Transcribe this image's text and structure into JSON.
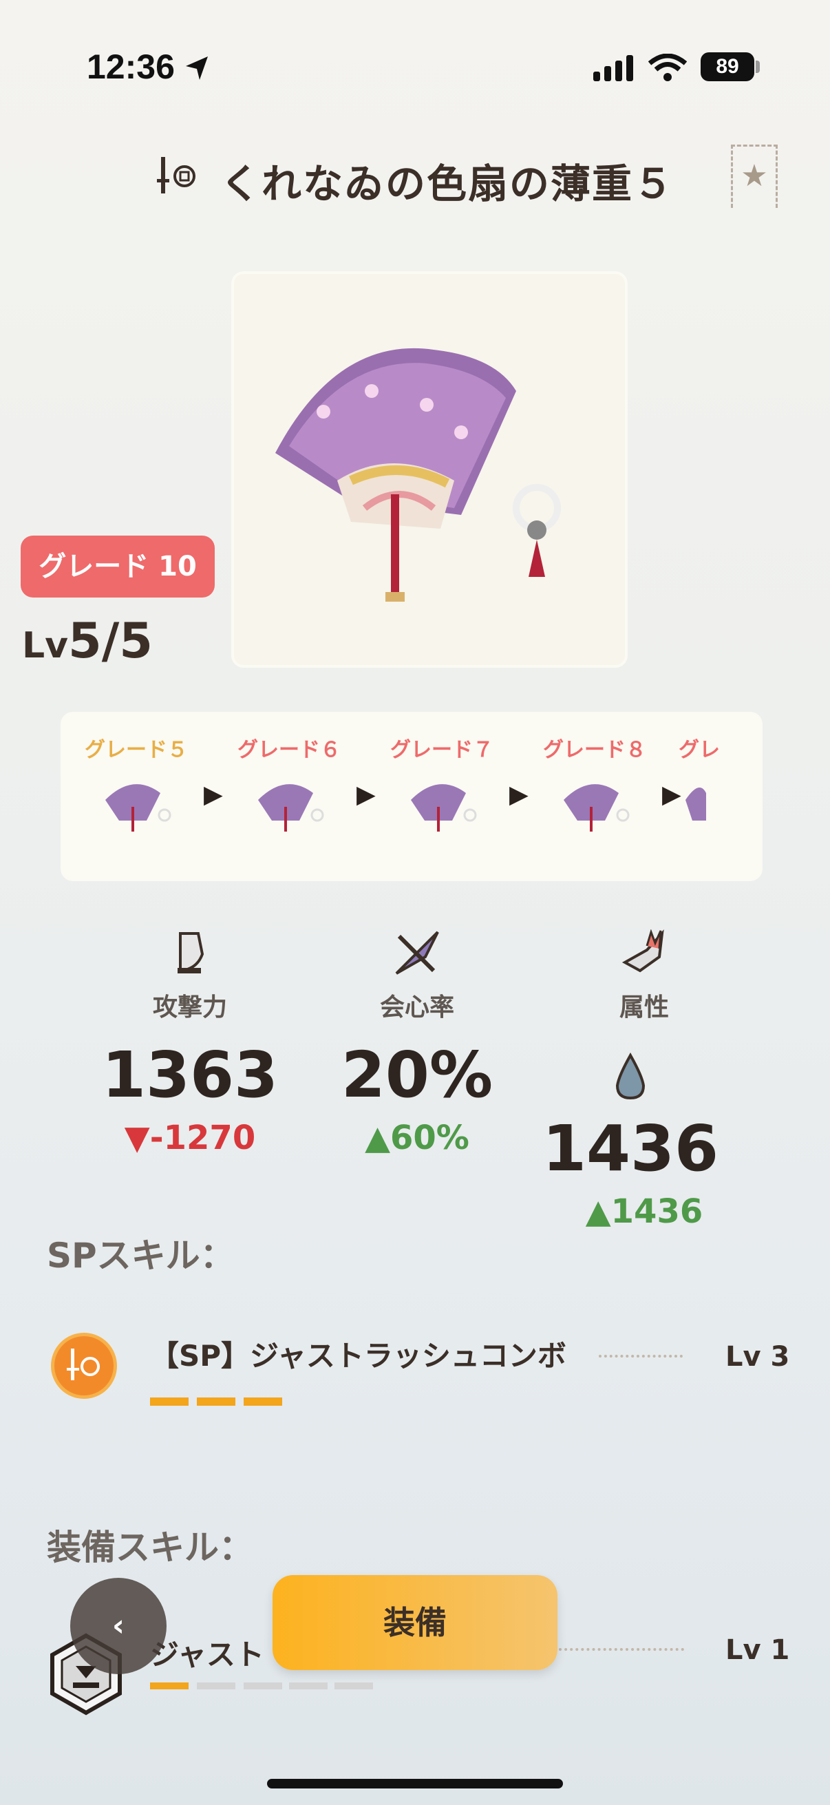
{
  "status_bar": {
    "time": "12:36",
    "battery": "89"
  },
  "header": {
    "title": "くれなゐの色扇の薄重５"
  },
  "weapon": {
    "grade_badge": "グレード 10",
    "level_prefix": "Lv",
    "level": "5/5"
  },
  "grades": [
    {
      "label": "グレード５",
      "current": true
    },
    {
      "label": "グレード６",
      "current": false
    },
    {
      "label": "グレード７",
      "current": false
    },
    {
      "label": "グレード８",
      "current": false
    },
    {
      "label": "グレ",
      "current": false
    }
  ],
  "stats": {
    "attack": {
      "label": "攻撃力",
      "value": "1363",
      "delta": "▼-1270"
    },
    "critical": {
      "label": "会心率",
      "value": "20%",
      "delta": "▲60%"
    },
    "element": {
      "label": "属性",
      "value": "1436",
      "delta": "▲1436"
    }
  },
  "sp_skills": {
    "heading": "SPスキル：",
    "items": [
      {
        "name": "【SP】ジャストラッシュコンボ",
        "level": "Lv 3",
        "filled": 3,
        "total": 3
      }
    ]
  },
  "equip_skills": {
    "heading": "装備スキル：",
    "items": [
      {
        "name": "ジャスト",
        "level": "Lv 1",
        "filled": 1,
        "total": 5
      }
    ]
  },
  "actions": {
    "equip": "装備"
  },
  "colors": {
    "grade_badge": "#ef6a6a",
    "current_grade": "#e8ae45",
    "other_grade": "#ee6a6a",
    "down": "#d8383b",
    "up": "#4f9a49",
    "accent": "#fdb21f"
  },
  "icons": [
    "location-arrow-icon",
    "signal-icon",
    "wifi-icon",
    "weapon-type-icon",
    "star-icon",
    "attack-icon",
    "critical-icon",
    "element-icon",
    "water-drop-icon",
    "sp-skill-icon",
    "equip-skill-icon",
    "chevron-left-icon"
  ]
}
